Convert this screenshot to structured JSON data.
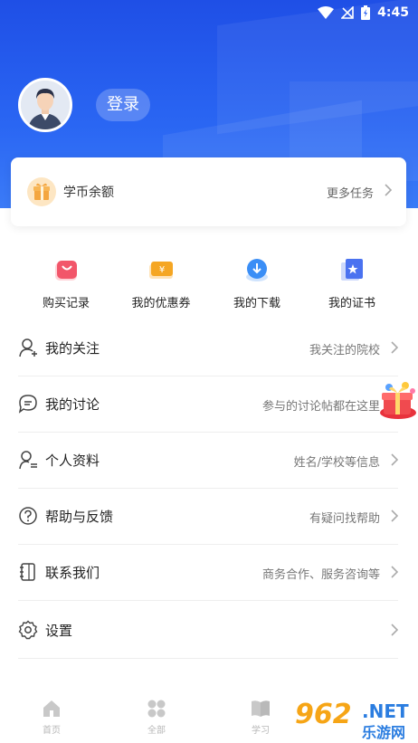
{
  "status_bar": {
    "time": "4:45",
    "icons": [
      "wifi-icon",
      "signal-off-icon",
      "battery-charging-icon"
    ]
  },
  "header": {
    "login_label": "登录",
    "colors": {
      "primary": "#2a5ff0"
    }
  },
  "coin_card": {
    "label": "学币余额",
    "more_label": "更多任务"
  },
  "quick_actions": [
    {
      "label": "购买记录",
      "icon": "shopping-bag-icon",
      "color": "#f2566a"
    },
    {
      "label": "我的优惠券",
      "icon": "coupon-icon",
      "color": "#f5a623"
    },
    {
      "label": "我的下载",
      "icon": "download-cloud-icon",
      "color": "#3a8ef6"
    },
    {
      "label": "我的证书",
      "icon": "certificate-icon",
      "color": "#4a72f0"
    }
  ],
  "menu": [
    {
      "label": "我的关注",
      "hint": "我关注的院校",
      "icon": "user-follow-icon"
    },
    {
      "label": "我的讨论",
      "hint": "参与的讨论帖都在这里",
      "icon": "chat-bubble-icon"
    },
    {
      "label": "个人资料",
      "hint": "姓名/学校等信息",
      "icon": "profile-icon"
    },
    {
      "label": "帮助与反馈",
      "hint": "有疑问找帮助",
      "icon": "help-icon"
    },
    {
      "label": "联系我们",
      "hint": "商务合作、服务咨询等",
      "icon": "contact-book-icon"
    },
    {
      "label": "设置",
      "hint": "",
      "icon": "settings-gear-icon"
    }
  ],
  "tabbar": [
    {
      "label": "首页",
      "icon": "home-icon"
    },
    {
      "label": "全部",
      "icon": "grid-icon"
    },
    {
      "label": "学习",
      "icon": "book-icon"
    }
  ],
  "watermark": {
    "number": "962",
    "net": ".NET",
    "cn": "乐游网"
  }
}
